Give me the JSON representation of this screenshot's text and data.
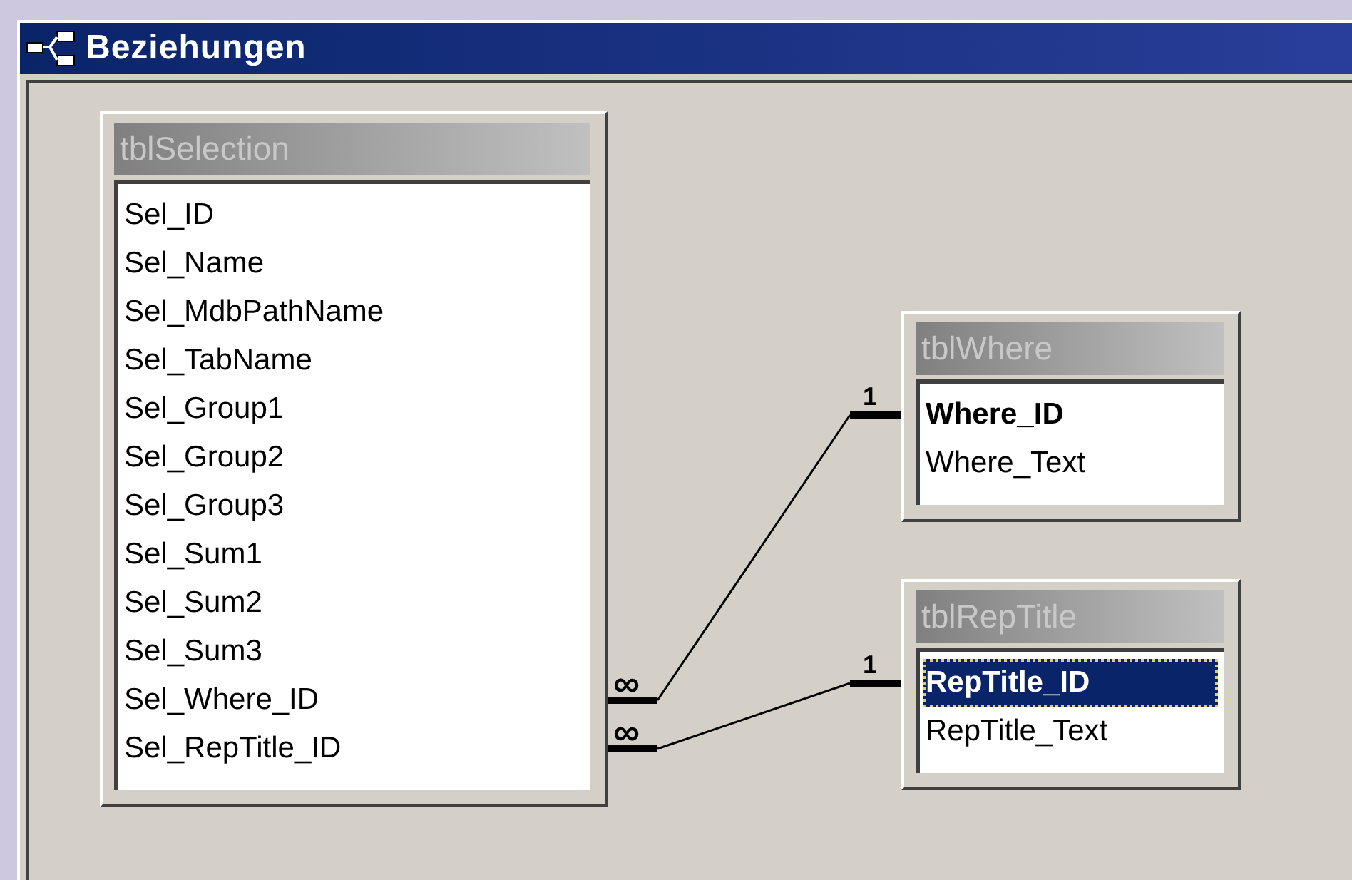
{
  "window": {
    "title": "Beziehungen"
  },
  "tables": [
    {
      "name": "tblSelection",
      "fields": [
        {
          "name": "Sel_ID",
          "key": false,
          "selected": false
        },
        {
          "name": "Sel_Name",
          "key": false,
          "selected": false
        },
        {
          "name": "Sel_MdbPathName",
          "key": false,
          "selected": false
        },
        {
          "name": "Sel_TabName",
          "key": false,
          "selected": false
        },
        {
          "name": "Sel_Group1",
          "key": false,
          "selected": false
        },
        {
          "name": "Sel_Group2",
          "key": false,
          "selected": false
        },
        {
          "name": "Sel_Group3",
          "key": false,
          "selected": false
        },
        {
          "name": "Sel_Sum1",
          "key": false,
          "selected": false
        },
        {
          "name": "Sel_Sum2",
          "key": false,
          "selected": false
        },
        {
          "name": "Sel_Sum3",
          "key": false,
          "selected": false
        },
        {
          "name": "Sel_Where_ID",
          "key": false,
          "selected": false
        },
        {
          "name": "Sel_RepTitle_ID",
          "key": false,
          "selected": false
        }
      ]
    },
    {
      "name": "tblWhere",
      "fields": [
        {
          "name": "Where_ID",
          "key": true,
          "selected": false
        },
        {
          "name": "Where_Text",
          "key": false,
          "selected": false
        }
      ]
    },
    {
      "name": "tblRepTitle",
      "fields": [
        {
          "name": "RepTitle_ID",
          "key": true,
          "selected": true
        },
        {
          "name": "RepTitle_Text",
          "key": false,
          "selected": false
        }
      ]
    }
  ],
  "relationships": [
    {
      "many_label": "∞",
      "one_label": "1"
    },
    {
      "many_label": "∞",
      "one_label": "1"
    }
  ]
}
